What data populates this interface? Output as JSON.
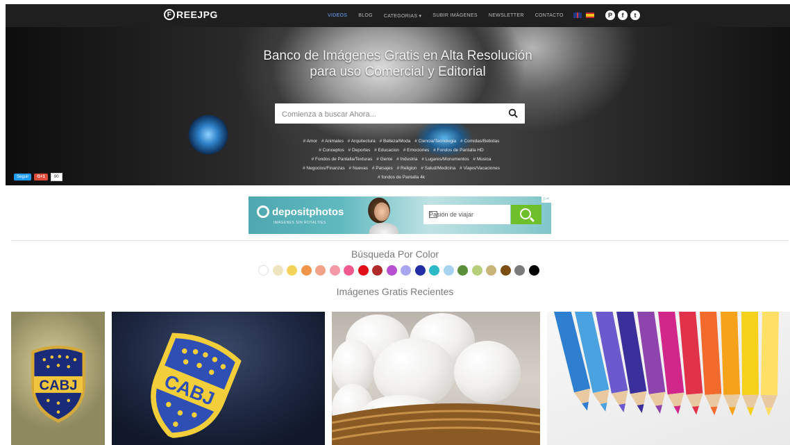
{
  "header": {
    "logo_mark": "F",
    "logo_text": "REEJPG",
    "nav": [
      "VIDEOS",
      "BLOG",
      "CATEGORIAS ▾",
      "SUBIR IMÁGENES",
      "NEWSLETTER",
      "CONTACTO"
    ],
    "active_nav": "VIDEOS",
    "social_icons": [
      "pinterest-icon",
      "facebook-icon",
      "twitter-icon"
    ],
    "flags": [
      "uk-flag-icon",
      "spain-flag-icon"
    ]
  },
  "hero": {
    "title_line1": "Banco de Imágenes Gratis en Alta Resolución",
    "title_line2": "para uso Comercial y Editorial",
    "search_placeholder": "Comienza a buscar Ahora...",
    "tags": [
      "# Amor",
      "# Animales",
      "# Arquitectura",
      "# Belleza/Moda",
      "# Ciencia/Tecnologia",
      "# Comidas/Bebidas",
      "# Conceptos",
      "# Deportes",
      "# Educacion",
      "# Emociones",
      "# Fondos de Pantalla HD",
      "# Fondos de Pantalla/Texturas",
      "# Gente",
      "# Industria",
      "# Lugares/Monumentos",
      "# Musica",
      "# Negocios/Finanzas",
      "# Nuevas",
      "# Paisajes",
      "# Religion",
      "# Salud/Medicina",
      "# Viajes/Vacaciones",
      "# fondos de Pantalla 4k"
    ],
    "share": {
      "twitter": "Seguir",
      "gplus": "G+1",
      "count": "90"
    }
  },
  "ad": {
    "brand": "depositphotos",
    "tagline": "IMÁGENES SIN ROYALTIES",
    "search_value": "Pasión de viajar",
    "corner": "▷×"
  },
  "colors_section": {
    "title": "Búsqueda Por Color",
    "swatches": [
      "#ffffff",
      "#efe4c0",
      "#f3d35a",
      "#f0954a",
      "#f1a288",
      "#f19aa6",
      "#ef5a8f",
      "#e0101a",
      "#b02a2a",
      "#b64fd0",
      "#a8a6ef",
      "#1f2ea5",
      "#2bb9c6",
      "#a7d3f0",
      "#5a8f3a",
      "#b6cf7a",
      "#c9b57a",
      "#7b4f13",
      "#7a7a7a",
      "#000000"
    ]
  },
  "recent": {
    "title": "Imágenes Gratis Recientes",
    "crest_text": "CABJ"
  },
  "colors": {
    "navbar": "#1f1f1f",
    "active_nav": "#6aa7ff",
    "ad_button": "#6fbf2c"
  }
}
